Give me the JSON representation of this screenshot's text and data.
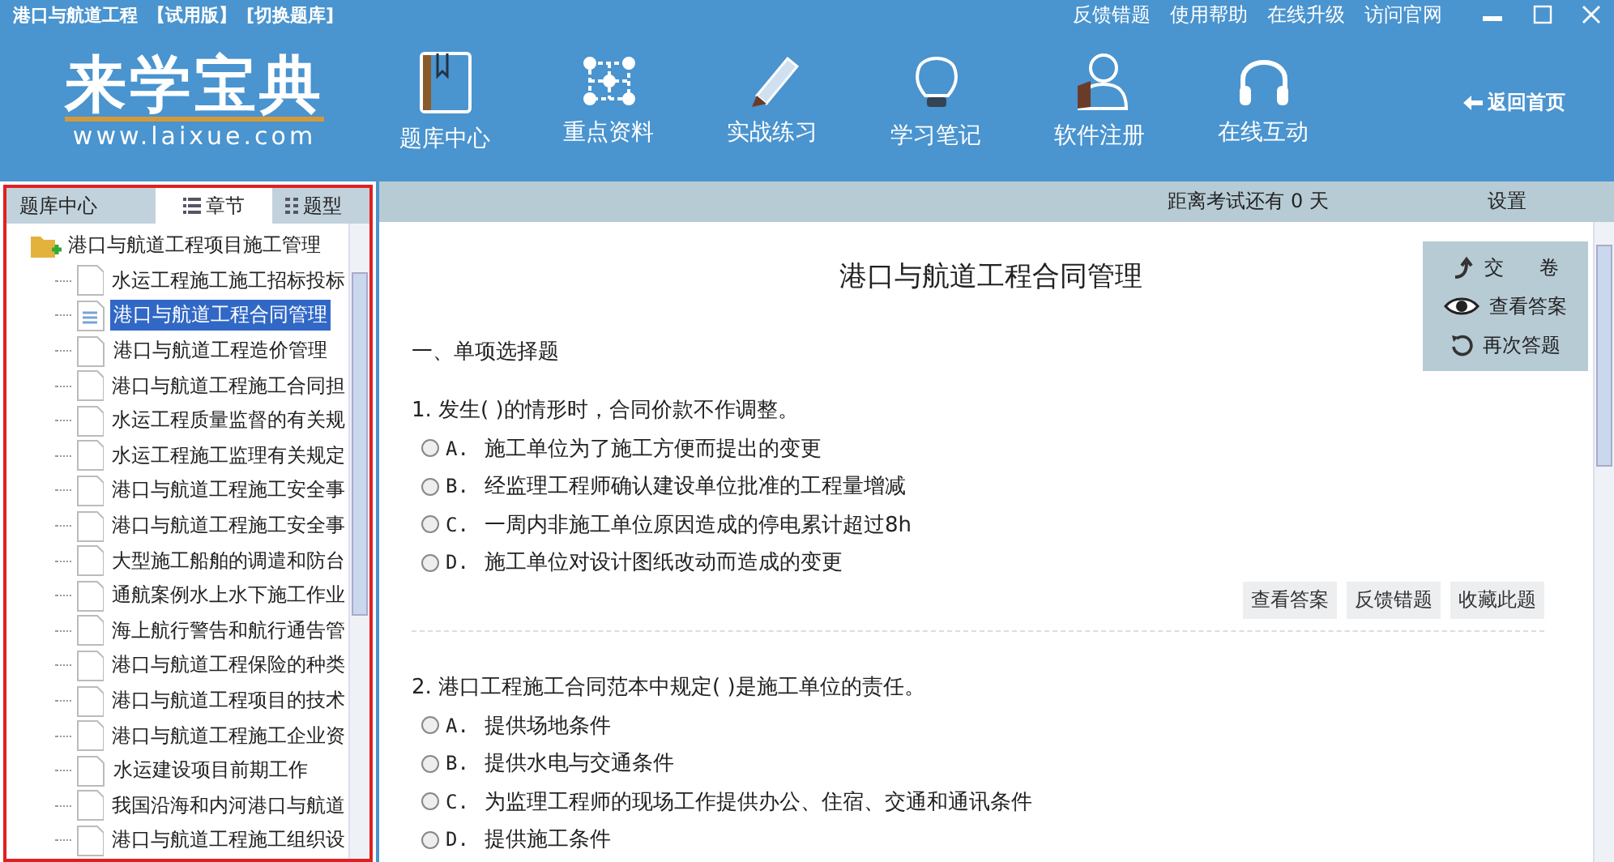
{
  "window": {
    "title": "港口与航道工程",
    "edition": "【试用版】",
    "switch": "[切换题库]",
    "links": [
      "反馈错题",
      "使用帮助",
      "在线升级",
      "访问官网"
    ]
  },
  "logo": {
    "text": "来学宝典",
    "url": "www.laixue.com"
  },
  "nav": [
    {
      "label": "题库中心"
    },
    {
      "label": "重点资料"
    },
    {
      "label": "实战练习"
    },
    {
      "label": "学习笔记"
    },
    {
      "label": "软件注册"
    },
    {
      "label": "在线互动"
    }
  ],
  "back": "返回首页",
  "sidebar": {
    "tabs": [
      {
        "label": "题库中心",
        "selected": false
      },
      {
        "label": "章节",
        "selected": true
      },
      {
        "label": "题型",
        "selected": false
      }
    ],
    "tree": {
      "label": "港口与航道工程项目施工管理",
      "expanded": true,
      "children": [
        {
          "label": "水运工程施工施工招标投标",
          "selected": false
        },
        {
          "label": "港口与航道工程合同管理",
          "selected": true
        },
        {
          "label": "港口与航道工程造价管理",
          "selected": false
        },
        {
          "label": "港口与航道工程施工合同担",
          "selected": false
        },
        {
          "label": "水运工程质量监督的有关规",
          "selected": false
        },
        {
          "label": "水运工程施工监理有关规定",
          "selected": false
        },
        {
          "label": "港口与航道工程施工安全事",
          "selected": false
        },
        {
          "label": "港口与航道工程施工安全事",
          "selected": false
        },
        {
          "label": "大型施工船舶的调遣和防台",
          "selected": false
        },
        {
          "label": "通航案例水上水下施工作业",
          "selected": false
        },
        {
          "label": "海上航行警告和航行通告管",
          "selected": false
        },
        {
          "label": "港口与航道工程保险的种类",
          "selected": false
        },
        {
          "label": "港口与航道工程项目的技术",
          "selected": false
        },
        {
          "label": "港口与航道工程施工企业资",
          "selected": false
        },
        {
          "label": "水运建设项目前期工作",
          "selected": false
        },
        {
          "label": "我国沿海和内河港口与航道",
          "selected": false
        },
        {
          "label": "港口与航道工程施工组织设",
          "selected": false
        }
      ]
    }
  },
  "topbar": {
    "countdown": "距离考试还有 0 天",
    "settings": "设置"
  },
  "menu": [
    {
      "label": "交 卷"
    },
    {
      "label": "查看答案"
    },
    {
      "label": "再次答题"
    }
  ],
  "paper": {
    "title": "港口与航道工程合同管理",
    "section": "一、单项选择题",
    "questions": [
      {
        "number": "1.",
        "text": "发生( )的情形时，合同价款不作调整。",
        "options": [
          {
            "letter": "A.",
            "text": "施工单位为了施工方便而提出的变更",
            "selected": false
          },
          {
            "letter": "B.",
            "text": "经监理工程师确认建设单位批准的工程量增减",
            "selected": false
          },
          {
            "letter": "C.",
            "text": "一周内非施工单位原因造成的停电累计超过8h",
            "selected": false
          },
          {
            "letter": "D.",
            "text": "施工单位对设计图纸改动而造成的变更",
            "selected": false
          }
        ],
        "buttons": [
          "查看答案",
          "反馈错题",
          "收藏此题"
        ]
      },
      {
        "number": "2.",
        "text": "港口工程施工合同范本中规定( )是施工单位的责任。",
        "options": [
          {
            "letter": "A.",
            "text": "提供场地条件",
            "selected": false
          },
          {
            "letter": "B.",
            "text": "提供水电与交通条件",
            "selected": false
          },
          {
            "letter": "C.",
            "text": "为监理工程师的现场工作提供办公、住宿、交通和通讯条件",
            "selected": false
          },
          {
            "letter": "D.",
            "text": "提供施工条件",
            "selected": false
          }
        ]
      }
    ]
  }
}
